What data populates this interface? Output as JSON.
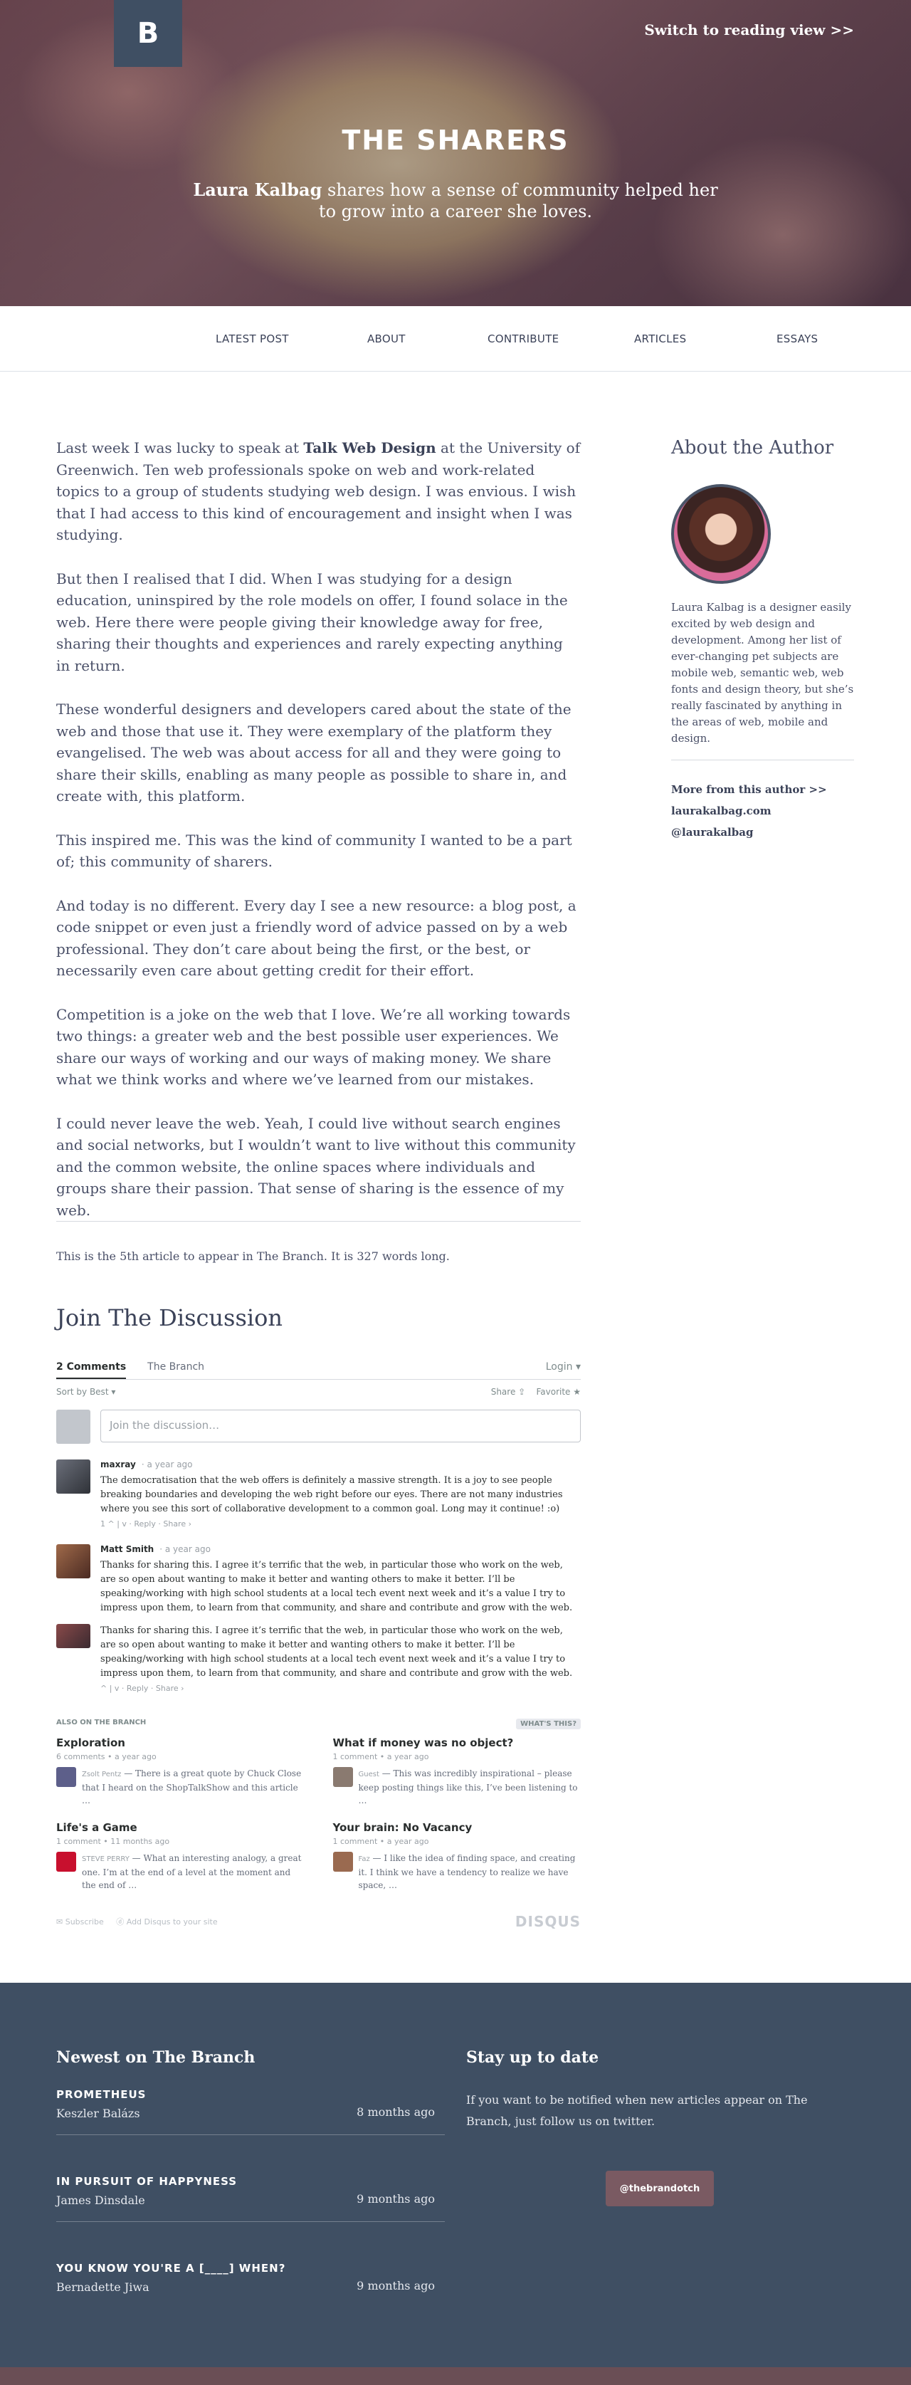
{
  "header": {
    "logo_letter": "B",
    "reading_link": "Switch to reading view >>",
    "title": "THE SHARERS",
    "author": "Laura Kalbag",
    "subtitle_rest": " shares how a sense of community helped her to grow into a career she loves."
  },
  "nav": [
    "LATEST POST",
    "ABOUT",
    "CONTRIBUTE",
    "ARTICLES",
    "ESSAYS"
  ],
  "article": {
    "p1_a": "Last week I was lucky to speak at ",
    "p1_b": "Talk Web Design",
    "p1_c": " at the University of Greenwich. Ten web professionals spoke on web and work-related topics to a group of students studying web design. I was envious. I wish that I had access to this kind of encouragement and insight when I was studying.",
    "p2": "But then I realised that I did. When I was studying for a design education, uninspired by the role models on offer, I found solace in the web. Here there were people giving their knowledge away for free, sharing their thoughts and experiences and rarely expecting anything in return.",
    "p3": "These wonderful designers and developers cared about the state of the web and those that use it. They were exemplary of the platform they evangelised. The web was about access for all and they were going to share their skills, enabling as many people as possible to share in, and create with, this platform.",
    "p4": "This inspired me. This was the kind of community I wanted to be a part of; this community of sharers.",
    "p5": "And today is no different. Every day I see a new resource: a blog post, a code snippet or even just a friendly word of advice passed on by a web professional. They don’t care about being the first, or the best, or necessarily even care about getting credit for their effort.",
    "p6": "Competition is a joke on the web that I love. We’re all working towards two things: a greater web and the best possible user experiences. We share our ways of working and our ways of making money. We share what we think works and where we’ve learned from our mistakes.",
    "p7": "I could never leave the web. Yeah, I could live without search engines and social networks, but I wouldn’t want to live without this community and the common website, the online spaces where individuals and groups share their passion. That sense of sharing is the essence of my web.",
    "meta": "This is the 5th article to appear in The Branch. It is 327 words long."
  },
  "sidebar": {
    "heading": "About the Author",
    "bio": "Laura Kalbag is a designer easily excited by web design and development. Among her list of ever-changing pet subjects are mobile web, semantic web, web fonts and design theory, but she’s really fascinated by anything in the areas of web, mobile and design.",
    "more": "More from this author >>",
    "site": "laurakalbag.com",
    "twitter": "@laurakalbag"
  },
  "discussion": {
    "title": "Join The Discussion",
    "tab_comments": "2 Comments",
    "tab_branch": "The Branch",
    "login": "Login ▾",
    "sort": "Sort by Best ▾",
    "share": "Share ⇪",
    "favorite": "Favorite ★",
    "placeholder": "Join the discussion…",
    "comments": [
      {
        "author": "maxray",
        "time": "· a year ago",
        "text": "The democratisation that the web offers is definitely a massive strength. It is a joy to see people breaking boundaries and developing the web right before our eyes. There are not many industries where you see this sort of collaborative development to a common goal. Long may it continue! :o)",
        "actions": "1 ^ | v · Reply · Share ›"
      },
      {
        "author": "Matt Smith",
        "time": "· a year ago",
        "text": "Thanks for sharing this. I agree it’s terrific that the web, in particular those who work on the web, are so open about wanting to make it better and wanting others to make it better. I’ll be speaking/working with high school students at a local tech event next week and it’s a value I try to impress upon them, to learn from that community, and share and contribute and grow with the web.",
        "actions": ""
      },
      {
        "author": "",
        "time": "",
        "text": "Thanks for sharing this. I agree it’s terrific that the web, in particular those who work on the web, are so open about wanting to make it better and wanting others to make it better. I’ll be speaking/working with high school students at a local tech event next week and it’s a value I try to impress upon them, to learn from that community, and share and contribute and grow with the web.",
        "actions": "^ | v · Reply · Share ›"
      }
    ],
    "also_on": "ALSO ON THE BRANCH",
    "whats_this": "WHAT'S THIS?",
    "also": [
      {
        "title": "Exploration",
        "sub": "6 comments • a year ago",
        "who": "Zsolt Pentz",
        "text": " — There is a great quote by Chuck Close that I heard on the ShopTalkShow and this article …"
      },
      {
        "title": "What if money was no object?",
        "sub": "1 comment • a year ago",
        "who": "Guest",
        "text": " — This was incredibly inspirational – please keep posting things like this, I’ve been listening to …"
      },
      {
        "title": "Life's a Game",
        "sub": "1 comment • 11 months ago",
        "who": "STEVE PERRY",
        "text": " — What an interesting analogy, a great one. I’m at the end of a level at the moment and the end of …"
      },
      {
        "title": "Your brain: No Vacancy",
        "sub": "1 comment • a year ago",
        "who": "Faz",
        "text": " — I like the idea of finding space, and creating it. I think we have a tendency to realize we have space, …"
      }
    ],
    "subscribe": "✉ Subscribe",
    "add_disqus": "ⓓ Add Disqus to your site",
    "brand": "DISQUS"
  },
  "footer": {
    "newest_heading": "Newest on The Branch",
    "items": [
      {
        "title": "PROMETHEUS",
        "author": "Keszler Balázs",
        "date": "8 months ago"
      },
      {
        "title": "IN PURSUIT OF HAPPYNESS",
        "author": "James Dinsdale",
        "date": "9 months ago"
      },
      {
        "title": "YOU KNOW YOU'RE A [____] WHEN?",
        "author": "Bernadette Jiwa",
        "date": "9 months ago"
      }
    ],
    "stay_heading": "Stay up to date",
    "stay_text": "If you want to be notified when new articles appear on The Branch, just follow us on twitter.",
    "twitter_button": "@thebrandotch"
  }
}
